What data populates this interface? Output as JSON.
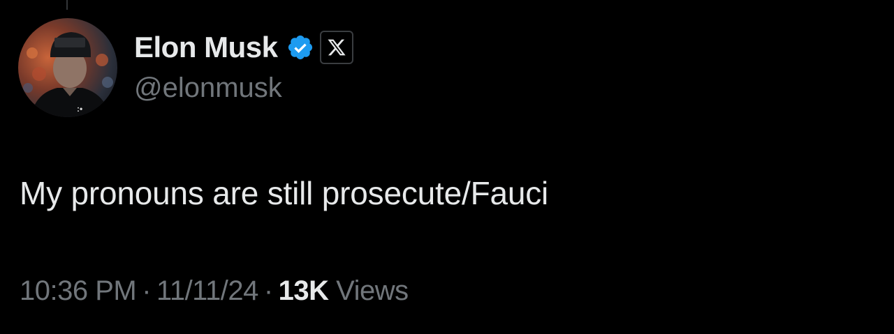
{
  "tweet": {
    "author": {
      "display_name": "Elon Musk",
      "handle": "@elonmusk",
      "verified_icon": "verified-badge-icon",
      "affiliation_icon": "x-logo-icon"
    },
    "text": "My pronouns are still prosecute/Fauci",
    "meta": {
      "time": "10:36 PM",
      "date": "11/11/24",
      "separator": "·",
      "views_count": "13K",
      "views_label": "Views"
    }
  },
  "colors": {
    "background": "#000000",
    "primary_text": "#e7e9ea",
    "secondary_text": "#71767b",
    "verified_blue": "#1d9bf0"
  }
}
